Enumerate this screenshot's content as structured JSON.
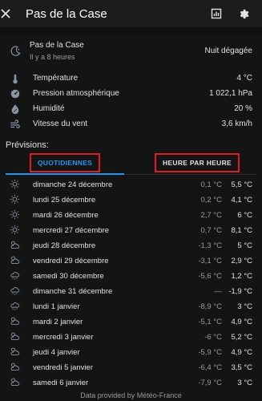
{
  "window": {
    "title": "Pas de la Case"
  },
  "location": {
    "name": "Pas de la Case",
    "updated": "Il y a 8 heures",
    "condition": "Nuit dégagée"
  },
  "attributes": [
    {
      "label": "Température",
      "value": "4 °C",
      "icon": "thermometer-icon"
    },
    {
      "label": "Pression atmosphérique",
      "value": "1 022,1 hPa",
      "icon": "gauge-icon"
    },
    {
      "label": "Humidité",
      "value": "20 %",
      "icon": "water-percent-icon"
    },
    {
      "label": "Vitesse du vent",
      "value": "3,6 km/h",
      "icon": "wind-icon"
    }
  ],
  "forecast_title": "Prévisions:",
  "tabs": {
    "daily": "QUOTIDIENNES",
    "hourly": "HEURE PAR HEURE",
    "active": "daily"
  },
  "forecast": [
    {
      "day": "dimanche 24 décembre",
      "low": "0,1 °C",
      "high": "5,5 °C",
      "icon": "sunny-icon"
    },
    {
      "day": "lundi 25 décembre",
      "low": "0,2 °C",
      "high": "4,1 °C",
      "icon": "sunny-icon"
    },
    {
      "day": "mardi 26 décembre",
      "low": "2,7 °C",
      "high": "6 °C",
      "icon": "sunny-icon"
    },
    {
      "day": "mercredi 27 décembre",
      "low": "0,7 °C",
      "high": "8,1 °C",
      "icon": "sunny-icon"
    },
    {
      "day": "jeudi 28 décembre",
      "low": "-1,3 °C",
      "high": "5 °C",
      "icon": "partly-cloudy-icon"
    },
    {
      "day": "vendredi 29 décembre",
      "low": "-3,1 °C",
      "high": "2,9 °C",
      "icon": "partly-cloudy-icon"
    },
    {
      "day": "samedi 30 décembre",
      "low": "-5,6 °C",
      "high": "1,2 °C",
      "icon": "snowy-icon"
    },
    {
      "day": "dimanche 31 décembre",
      "low": "—",
      "high": "-1,9 °C",
      "icon": "snowy-icon"
    },
    {
      "day": "lundi 1 janvier",
      "low": "-8,9 °C",
      "high": "3 °C",
      "icon": "snowy-icon"
    },
    {
      "day": "mardi 2 janvier",
      "low": "-5,1 °C",
      "high": "4,9 °C",
      "icon": "partly-cloudy-icon"
    },
    {
      "day": "mercredi 3 janvier",
      "low": "-6 °C",
      "high": "5,2 °C",
      "icon": "partly-cloudy-icon"
    },
    {
      "day": "jeudi 4 janvier",
      "low": "-5,9 °C",
      "high": "4,9 °C",
      "icon": "partly-cloudy-icon"
    },
    {
      "day": "vendredi 5 janvier",
      "low": "-6,4 °C",
      "high": "3,5 °C",
      "icon": "partly-cloudy-icon"
    },
    {
      "day": "samedi 6 janvier",
      "low": "-7,9 °C",
      "high": "3 °C",
      "icon": "partly-cloudy-icon"
    }
  ],
  "footer": "Data provided by Météo-France",
  "colors": {
    "accent": "#2196f3",
    "highlight_box": "#e01b24",
    "background": "#111111",
    "icon": "#8a95a5"
  }
}
